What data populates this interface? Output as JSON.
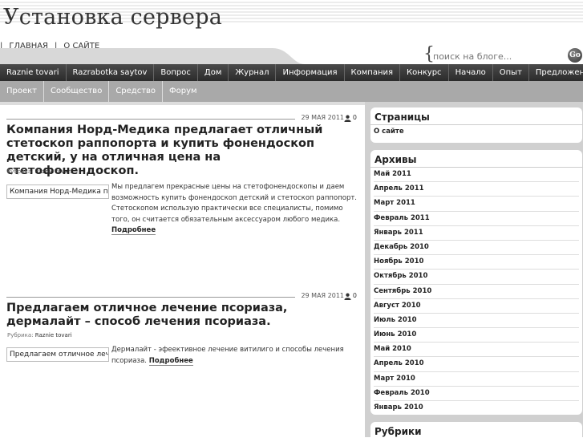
{
  "site": {
    "title": "Установка сервера"
  },
  "toplinks": [
    {
      "label": "ГЛАВНАЯ"
    },
    {
      "label": "О САЙТЕ"
    }
  ],
  "search": {
    "placeholder": "поиск на блоге...",
    "button": "Go"
  },
  "nav_primary": [
    "Raznie tovari",
    "Razrabotka saytov",
    "Вопрос",
    "Дом",
    "Журнал",
    "Информация",
    "Компания",
    "Конкурс",
    "Начало",
    "Опыт",
    "Предложение"
  ],
  "nav_secondary": [
    "Проект",
    "Сообщество",
    "Средство",
    "Форум"
  ],
  "posts": [
    {
      "date": "29 МАЯ 2011",
      "comments": "0",
      "title": "Компания Норд-Медика предлагает отличный стетоскоп раппопорта и купить фонендоскоп детский, у на отличная цена на стетофонендоскоп.",
      "category_label": "Рубрика:",
      "category": "Raznie tovari",
      "thumb_text": "Компания Норд-Медика предлагает",
      "excerpt": "Мы предлагем прекрасные цены на стетофонендоскопы и даем возможность купить фонендоскоп детский и стетоскоп раппопорт. Стетоскопом использую практически все специалисты, помимо того, он считается обязательным аксессуаром любого медика.",
      "more": "Подробнее"
    },
    {
      "date": "29 МАЯ 2011",
      "comments": "0",
      "title": "Предлагаем отличное лечение псориаза, дермалайт – способ лечения псориаза.",
      "category_label": "Рубрика:",
      "category": "Raznie tovari",
      "thumb_text": "Предлагаем отличное лечение",
      "excerpt": "Дермалайт - эфеективное лечение витилиго и способы лечения псориаза.",
      "more": "Подробнее"
    }
  ],
  "sidebar": {
    "pages": {
      "title": "Страницы",
      "items": [
        "О сайте"
      ]
    },
    "archives": {
      "title": "Архивы",
      "items": [
        "Май 2011",
        "Апрель 2011",
        "Март 2011",
        "Февраль 2011",
        "Январь 2011",
        "Декабрь 2010",
        "Ноябрь 2010",
        "Октябрь 2010",
        "Сентябрь 2010",
        "Август 2010",
        "Июль 2010",
        "Июнь 2010",
        "Май 2010",
        "Апрель 2010",
        "Март 2010",
        "Февраль 2010",
        "Январь 2010"
      ]
    },
    "categories": {
      "title": "Рубрики"
    }
  },
  "colors": {
    "nav_primary_bg": "#333333",
    "nav_secondary_bg": "#a9a9a9",
    "sidebar_bg": "#d0d0d0"
  }
}
